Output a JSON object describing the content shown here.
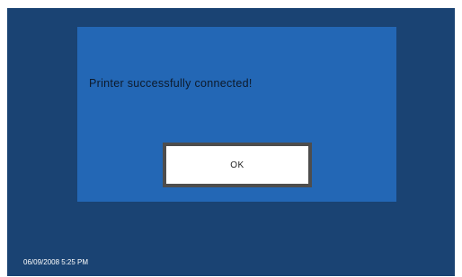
{
  "dialog": {
    "message": "Printer successfully connected!",
    "ok_label": "OK"
  },
  "status": {
    "datetime": "06/09/2008 5:25 PM"
  },
  "colors": {
    "screen_background": "#1a4373",
    "dialog_background": "#2367b5",
    "button_border": "#4d4d4d",
    "button_background": "#ffffff"
  }
}
